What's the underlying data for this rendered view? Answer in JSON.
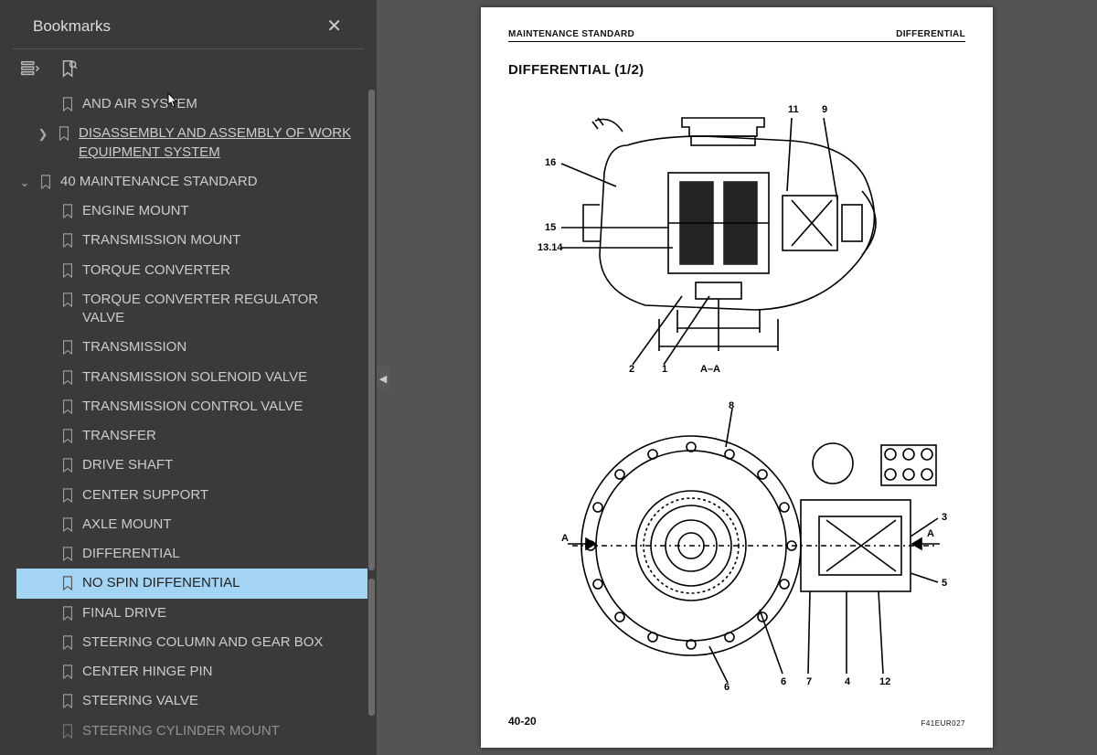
{
  "sidebar": {
    "title": "Bookmarks",
    "tree": {
      "partial_top_a": "AND AIR SYSTEM",
      "item_disassembly": "DISASSEMBLY AND ASSEMBLY OF WORK EQUIPMENT SYSTEM",
      "section_40": "40 MAINTENANCE STANDARD",
      "children": {
        "engine_mount": "ENGINE MOUNT",
        "transmission_mount": "TRANSMISSION MOUNT",
        "torque_converter": "TORQUE CONVERTER",
        "torque_converter_regulator_valve": "TORQUE CONVERTER REGULATOR VALVE",
        "transmission": "TRANSMISSION",
        "transmission_solenoid_valve": "TRANSMISSION SOLENOID VALVE",
        "transmission_control_valve": "TRANSMISSION CONTROL VALVE",
        "transfer": "TRANSFER",
        "drive_shaft": "DRIVE SHAFT",
        "center_support": "CENTER SUPPORT",
        "axle_mount": "AXLE MOUNT",
        "differential": "DIFFERENTIAL",
        "no_spin_differential": "NO SPIN DIFFENENTIAL",
        "final_drive": "FINAL DRIVE",
        "steering_column_and_gear_box": "STEERING COLUMN AND GEAR BOX",
        "center_hinge_pin": "CENTER HINGE PIN",
        "steering_valve": "STEERING VALVE",
        "steering_cylinder_mount": "STEERING CYLINDER MOUNT"
      }
    }
  },
  "page": {
    "header_left": "MAINTENANCE STANDARD",
    "header_right": "DIFFERENTIAL",
    "title": "DIFFERENTIAL (1/2)",
    "section_label": "A–A",
    "page_number": "40-20",
    "figure_code": "F41EUR027",
    "callouts_top": {
      "c16": "16",
      "c15": "15",
      "c1314": "13.14",
      "c2": "2",
      "c1": "1",
      "c11": "11",
      "c9": "9"
    },
    "callouts_bottom": {
      "c8": "8",
      "c3": "3",
      "c5": "5",
      "c12": "12",
      "c4": "4",
      "c7": "7",
      "c6": "6",
      "cA1": "A",
      "cA2": "A"
    }
  }
}
